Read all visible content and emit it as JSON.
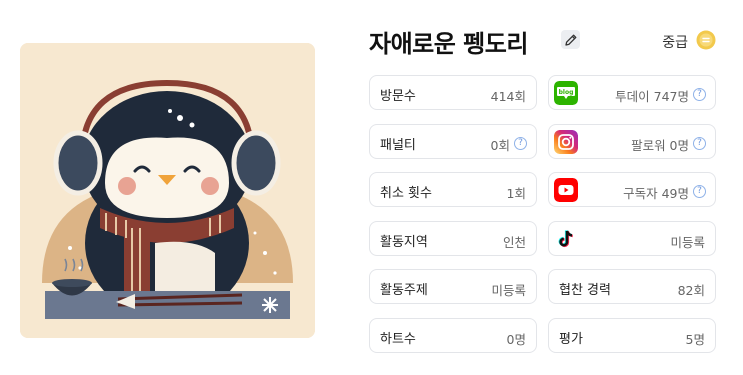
{
  "profile": {
    "name": "자애로운 펭도리",
    "grade": "중급"
  },
  "left_stats": [
    {
      "label": "방문수",
      "value": "414회",
      "info": false
    },
    {
      "label": "패널티",
      "value": "0회",
      "info": true
    },
    {
      "label": "취소 횟수",
      "value": "1회",
      "info": false
    },
    {
      "label": "활동지역",
      "value": "인천",
      "info": false
    },
    {
      "label": "활동주제",
      "value": "미등록",
      "info": false
    },
    {
      "label": "하트수",
      "value": "0명",
      "info": false
    }
  ],
  "right_stats": [
    {
      "icon": "naver-blog-icon",
      "label": "",
      "value": "투데이 747명",
      "info": true
    },
    {
      "icon": "instagram-icon",
      "label": "",
      "value": "팔로워 0명",
      "info": true
    },
    {
      "icon": "youtube-icon",
      "label": "",
      "value": "구독자 49명",
      "info": true
    },
    {
      "icon": "tiktok-icon",
      "label": "",
      "value": "미등록",
      "info": false
    },
    {
      "icon": "",
      "label": "협찬 경력",
      "value": "82회",
      "info": false
    },
    {
      "icon": "",
      "label": "평가",
      "value": "5명",
      "info": false
    }
  ],
  "icons": {
    "blog_text": "blog",
    "info_glyph": "?"
  },
  "colors": {
    "blog_green": "#2db400",
    "youtube_red": "#ff0000",
    "info_blue": "#6f98de",
    "grade_gold": "#f2c94c",
    "avatar_bg": "#f6e7cf"
  }
}
